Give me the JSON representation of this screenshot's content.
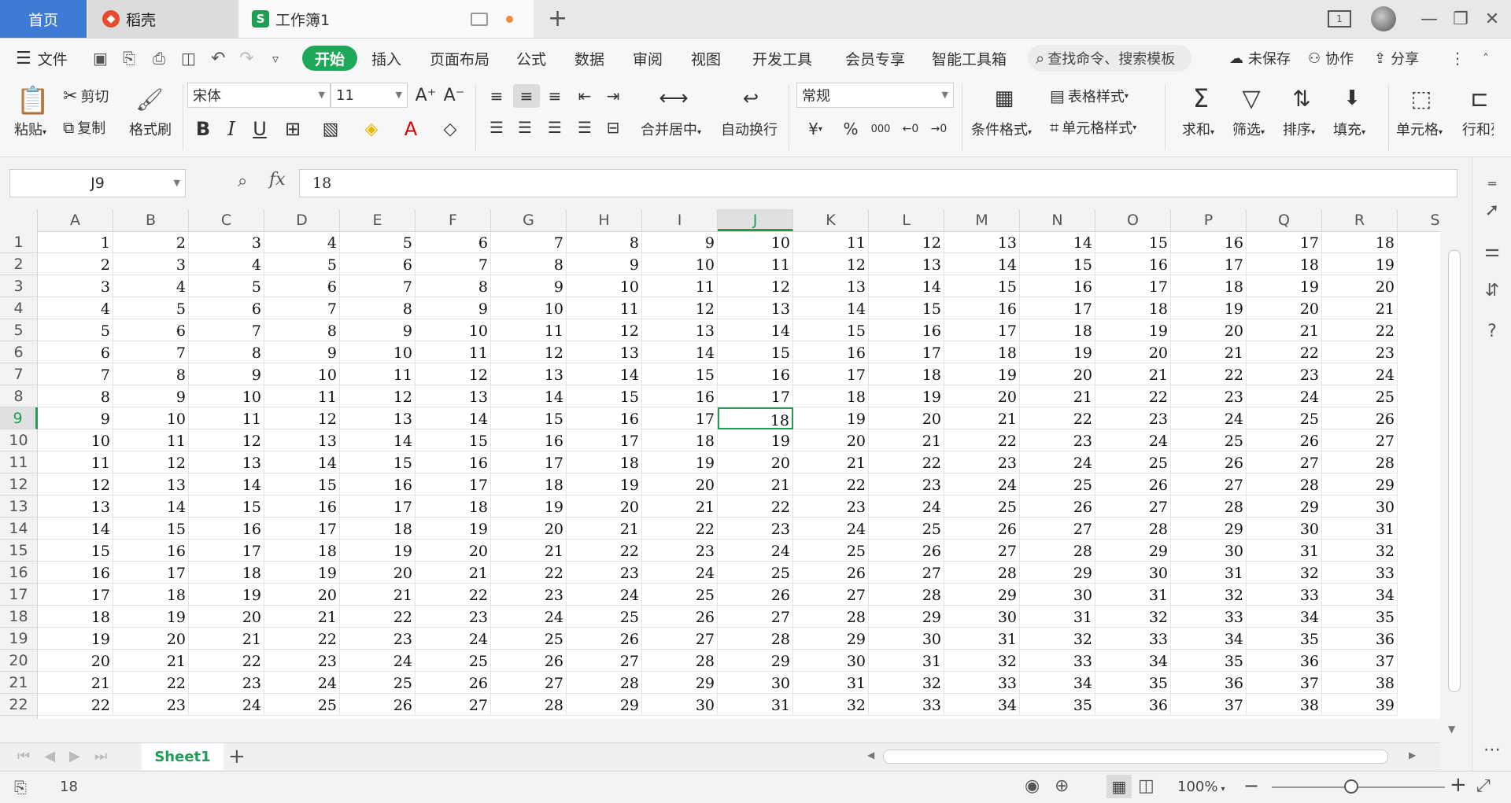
{
  "tabs": {
    "home": "首页",
    "docer": "稻壳",
    "workbook": "工作簿1",
    "new_tab": "+"
  },
  "menu": {
    "file": "文件",
    "start": "开始",
    "insert": "插入",
    "page_layout": "页面布局",
    "formula": "公式",
    "data": "数据",
    "review": "审阅",
    "view": "视图",
    "dev_tools": "开发工具",
    "member": "会员专享",
    "smart_tools": "智能工具箱",
    "search_placeholder": "查找命令、搜索模板",
    "unsaved": "未保存",
    "collab": "协作",
    "share": "分享"
  },
  "ribbon": {
    "paste": "粘贴",
    "cut": "剪切",
    "copy": "复制",
    "format_painter": "格式刷",
    "font_name": "宋体",
    "font_size": "11",
    "bold": "B",
    "italic": "I",
    "underline": "U",
    "merge_center": "合并居中",
    "wrap_text": "自动换行",
    "number_format": "常规",
    "currency": "¥",
    "percent": "%",
    "thousands": "000",
    "cond_format": "条件格式",
    "table_style": "表格样式",
    "cell_style": "单元格样式",
    "sum": "求和",
    "filter": "筛选",
    "sort": "排序",
    "fill": "填充",
    "cell": "单元格",
    "row_col": "行和列"
  },
  "formula_bar": {
    "name_box": "J9",
    "fx": "fx",
    "value": "18"
  },
  "columns": [
    "A",
    "B",
    "C",
    "D",
    "E",
    "F",
    "G",
    "H",
    "I",
    "J",
    "K",
    "L",
    "M",
    "N",
    "O",
    "P",
    "Q",
    "R",
    "S"
  ],
  "rows": [
    1,
    2,
    3,
    4,
    5,
    6,
    7,
    8,
    9,
    10,
    11,
    12,
    13,
    14,
    15,
    16,
    17,
    18,
    19,
    20,
    21,
    22
  ],
  "selected": {
    "col": "J",
    "row": 9,
    "value": 18
  },
  "sheets": [
    "Sheet1"
  ],
  "status": {
    "value": "18",
    "zoom": "100%"
  },
  "colors": {
    "accent": "#1e9d54",
    "home_tab": "#3e7bd6",
    "docer": "#e84a2f"
  }
}
